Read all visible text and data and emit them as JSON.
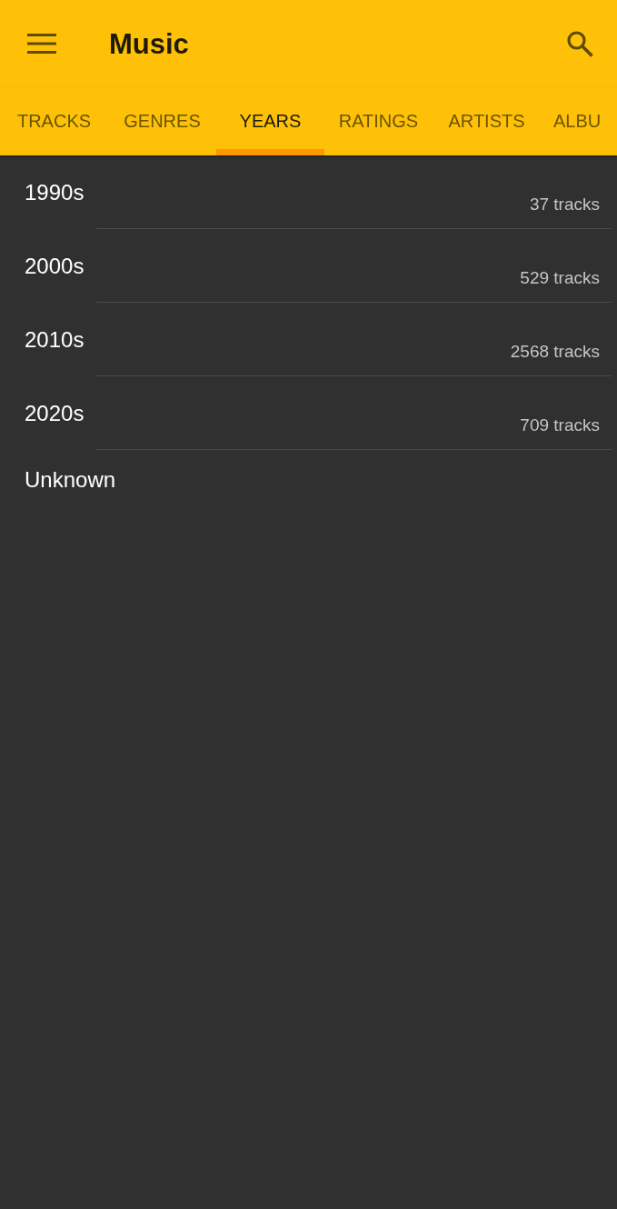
{
  "app_bar": {
    "title": "Music"
  },
  "tabs": [
    {
      "label": "TRACKS",
      "selected": false
    },
    {
      "label": "GENRES",
      "selected": false
    },
    {
      "label": "YEARS",
      "selected": true
    },
    {
      "label": "RATINGS",
      "selected": false
    },
    {
      "label": "ARTISTS",
      "selected": false
    },
    {
      "label": "ALBU",
      "selected": false
    }
  ],
  "years": [
    {
      "label": "1990s",
      "count": "37 tracks"
    },
    {
      "label": "2000s",
      "count": "529 tracks"
    },
    {
      "label": "2010s",
      "count": "2568 tracks"
    },
    {
      "label": "2020s",
      "count": "709 tracks"
    },
    {
      "label": "Unknown"
    }
  ]
}
